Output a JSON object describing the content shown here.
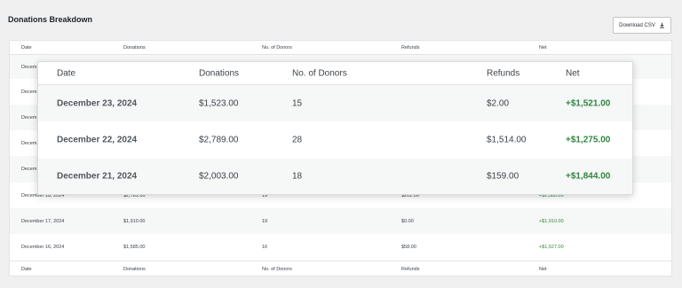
{
  "page": {
    "title": "Donations Breakdown",
    "download_label": "Download CSV"
  },
  "columns": [
    "Date",
    "Donations",
    "No. of Donors",
    "Refunds",
    "Net"
  ],
  "table": {
    "rows": [
      {
        "date": "December 23, 2024",
        "donations": "",
        "donors": "",
        "refunds": "",
        "net": ""
      },
      {
        "date": "December 22, 2024",
        "donations": "",
        "donors": "",
        "refunds": "",
        "net": ""
      },
      {
        "date": "December 21, 2024",
        "donations": "",
        "donors": "",
        "refunds": "",
        "net": ""
      },
      {
        "date": "December 20, 2024",
        "donations": "",
        "donors": "",
        "refunds": "",
        "net": ""
      },
      {
        "date": "December 19, 2024",
        "donations": "",
        "donors": "",
        "refunds": "",
        "net": ""
      },
      {
        "date": "December 18, 2024",
        "donations": "$2,781.00",
        "donors": "19",
        "refunds": "$201.00",
        "net": "+$2,580.00"
      },
      {
        "date": "December 17, 2024",
        "donations": "$1,910.00",
        "donors": "19",
        "refunds": "$0.00",
        "net": "+$1,910.00"
      },
      {
        "date": "December 16, 2024",
        "donations": "$1,585.00",
        "donors": "16",
        "refunds": "$58.00",
        "net": "+$1,527.00"
      }
    ],
    "visible_date_prefix": "Decem"
  },
  "popup": {
    "rows": [
      {
        "date": "December 23, 2024",
        "donations": "$1,523.00",
        "donors": "15",
        "refunds": "$2.00",
        "net": "+$1,521.00"
      },
      {
        "date": "December 22, 2024",
        "donations": "$2,789.00",
        "donors": "28",
        "refunds": "$1,514.00",
        "net": "+$1,275.00"
      },
      {
        "date": "December 21, 2024",
        "donations": "$2,003.00",
        "donors": "18",
        "refunds": "$159.00",
        "net": "+$1,844.00"
      }
    ]
  },
  "colors": {
    "net_positive": "#2e8540",
    "background": "#f0f0f1"
  },
  "icons": {
    "download": "download-icon"
  }
}
